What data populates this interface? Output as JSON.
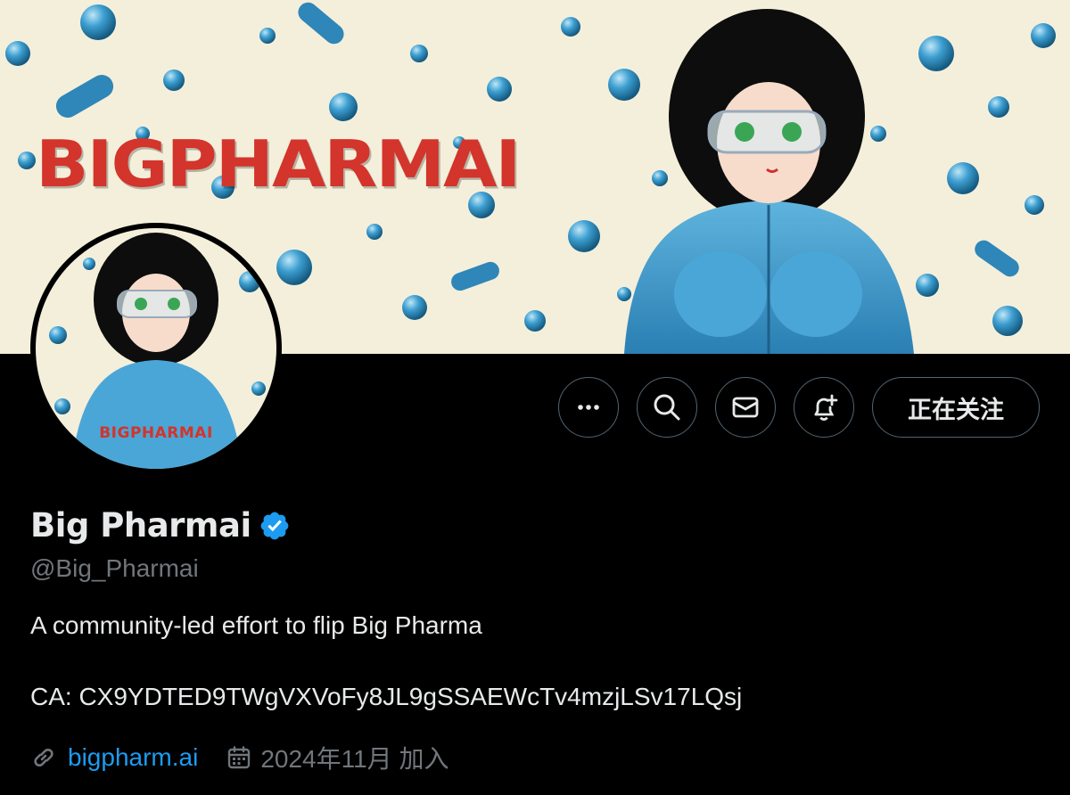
{
  "banner": {
    "title": "BIGPHARMAI",
    "accent_color": "#d3342b",
    "background_color": "#f4efdb"
  },
  "avatar": {
    "text": "BIGPHARMAI"
  },
  "actions": {
    "more_icon": "more-icon",
    "search_icon": "search-icon",
    "message_icon": "mail-icon",
    "notify_icon": "bell-plus-icon",
    "follow_label": "正在关注"
  },
  "profile": {
    "name": "Big Pharmai",
    "verified": true,
    "handle": "@Big_Pharmai",
    "bio": "A community-led effort to flip Big Pharma",
    "contract": "CA: CX9YDTED9TWgVXVoFy8JL9gSSAEWcTv4mzjLSv17LQsj",
    "website": "bigpharm.ai",
    "joined": "2024年11月 加入"
  },
  "colors": {
    "link": "#1d9bf0",
    "muted": "#71767b",
    "verified_badge": "#1d9bf0",
    "border": "#536471"
  }
}
